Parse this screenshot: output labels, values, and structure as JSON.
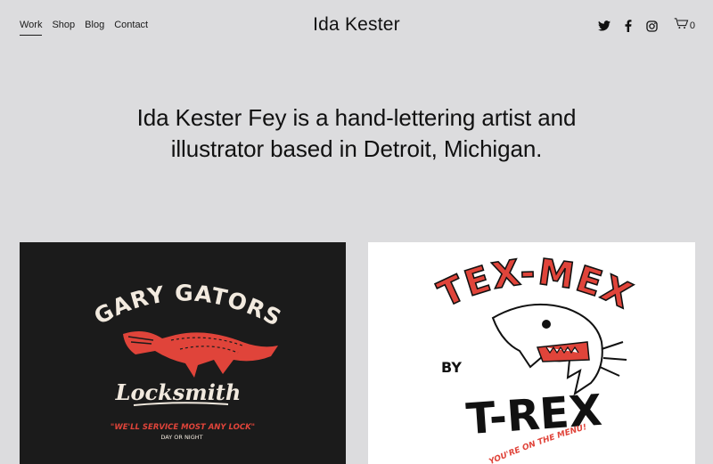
{
  "nav": {
    "items": [
      {
        "label": "Work",
        "active": true
      },
      {
        "label": "Shop",
        "active": false
      },
      {
        "label": "Blog",
        "active": false
      },
      {
        "label": "Contact",
        "active": false
      }
    ]
  },
  "brand": {
    "title": "Ida Kester"
  },
  "social": {
    "icons": [
      "twitter-icon",
      "facebook-icon",
      "instagram-icon"
    ],
    "cart_count": "0"
  },
  "intro": {
    "line1": "Ida Kester Fey is a hand-lettering artist and",
    "line2": "illustrator based in Detroit, Michigan."
  },
  "gallery": {
    "items": [
      {
        "title": "GARY GATORS",
        "script": "Locksmith",
        "tagline": "\"WE'LL SERVICE MOST ANY LOCK\"",
        "sub": "DAY OR NIGHT"
      },
      {
        "title": "TEX-MEX",
        "by": "BY",
        "name": "T-REX",
        "tagline": "\"YOU'RE ON THE MENU!\""
      }
    ]
  },
  "colors": {
    "background": "#dcdcde",
    "accent_red": "#e0443a",
    "ink": "#111111"
  }
}
